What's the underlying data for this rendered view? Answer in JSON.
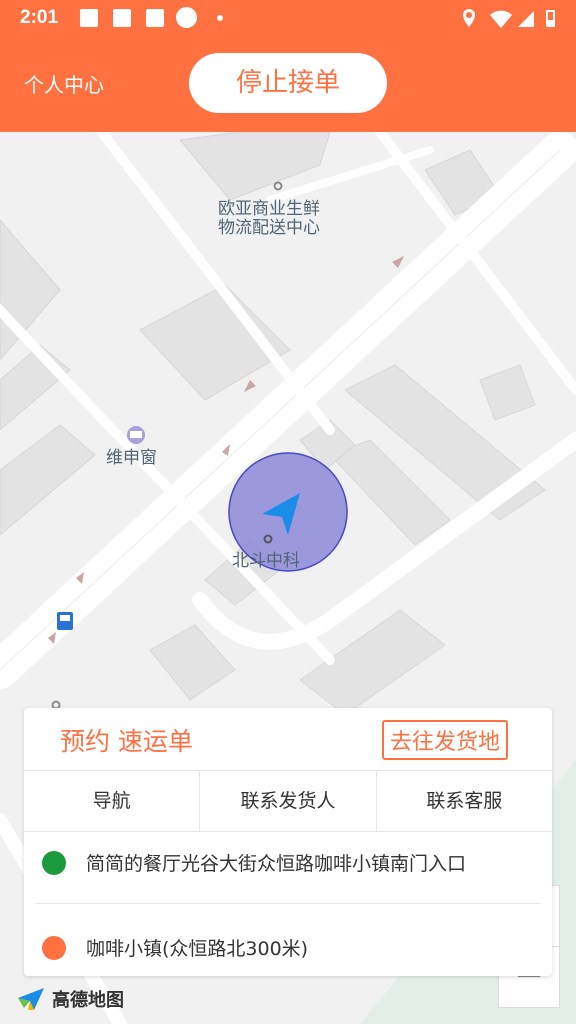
{
  "status_bar": {
    "time": "2:01"
  },
  "app_bar": {
    "profile_label": "个人中心",
    "stop_button": "停止接单"
  },
  "map": {
    "pois": [
      {
        "line1": "欧亚商业生鲜",
        "line2": "物流配送中心"
      },
      {
        "line1": "维申窗",
        "line2": ""
      },
      {
        "line1": "北斗中科",
        "line2": ""
      }
    ],
    "brand": "高德地图",
    "zoom_in": "+",
    "zoom_out": "−"
  },
  "order_card": {
    "booking_label": "预约 速运单",
    "goto_button": "去往发货地",
    "actions": [
      "导航",
      "联系发货人",
      "联系客服"
    ],
    "pickup_address": "简简的餐厅光谷大街众恒路咖啡小镇南门入口",
    "dropoff_address": "咖啡小镇(众恒路北300米)"
  },
  "colors": {
    "accent": "#ff7140",
    "pickup": "#1a9a3c",
    "dropoff": "#ff7140",
    "location_circle": "#8c8ad8"
  }
}
